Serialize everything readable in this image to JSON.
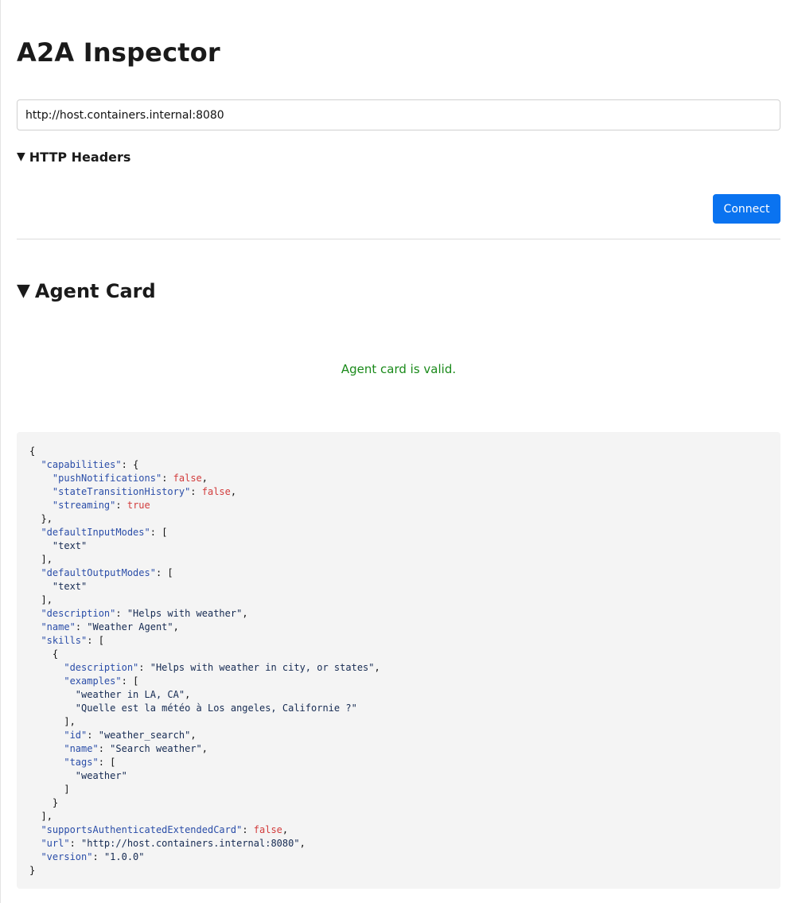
{
  "app": {
    "title": "A2A Inspector"
  },
  "connection": {
    "url_value": "http://host.containers.internal:8080",
    "headers_label": "HTTP Headers",
    "connect_label": "Connect"
  },
  "agent_card": {
    "section_label": "Agent Card",
    "validation_message": "Agent card is valid.",
    "json": {
      "capabilities": {
        "pushNotifications": false,
        "stateTransitionHistory": false,
        "streaming": true
      },
      "defaultInputModes": [
        "text"
      ],
      "defaultOutputModes": [
        "text"
      ],
      "description": "Helps with weather",
      "name": "Weather Agent",
      "skills": [
        {
          "description": "Helps with weather in city, or states",
          "examples": [
            "weather in LA, CA",
            "Quelle est la météo à Los angeles, Californie ?"
          ],
          "id": "weather_search",
          "name": "Search weather",
          "tags": [
            "weather"
          ]
        }
      ],
      "supportsAuthenticatedExtendedCard": false,
      "url": "http://host.containers.internal:8080",
      "version": "1.0.0"
    }
  },
  "colors": {
    "accent": "#0a73f0",
    "success": "#1a8a1a",
    "json_key": "#2a4da8",
    "json_boolean": "#d23c3c"
  },
  "icons": {
    "headers_toggle": "triangle-down-icon",
    "card_toggle": "triangle-down-icon"
  }
}
